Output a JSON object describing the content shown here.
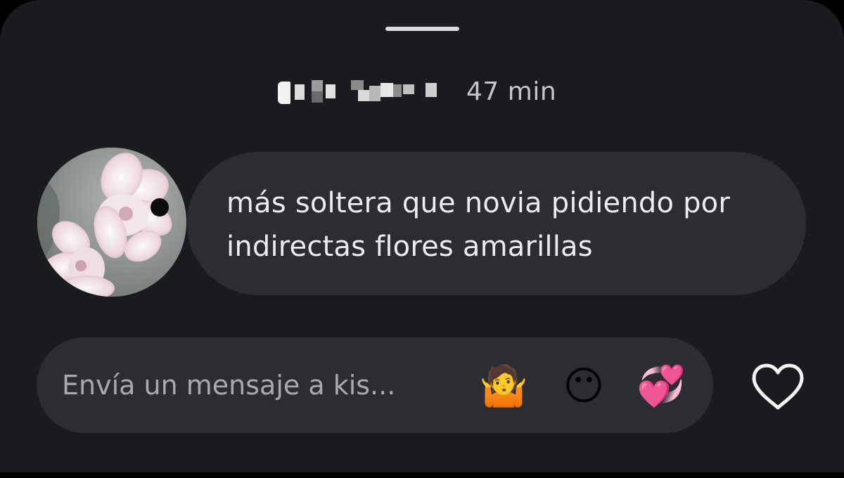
{
  "story_reply": {
    "header": {
      "username_pixelated": "",
      "time": "47 min"
    },
    "message": {
      "text": "más soltera que novia pidiendo por indirectas flores amarillas"
    },
    "composer": {
      "placeholder": "Envía un mensaje a kis...",
      "quick_reactions": [
        {
          "icon": "shrugging-person-emoji",
          "glyph": "🤷"
        },
        {
          "icon": "face-without-mouth-emoji",
          "glyph": "😶"
        },
        {
          "icon": "revolving-hearts-emoji",
          "glyph": "💞"
        }
      ],
      "like_icon": "heart-outline-icon"
    },
    "colors": {
      "sheet_background": "#1a1b1f",
      "bubble_background": "#2c2d33",
      "text_primary": "#ededee",
      "text_secondary": "#c6c7cb",
      "placeholder": "#a9aaaf"
    }
  }
}
